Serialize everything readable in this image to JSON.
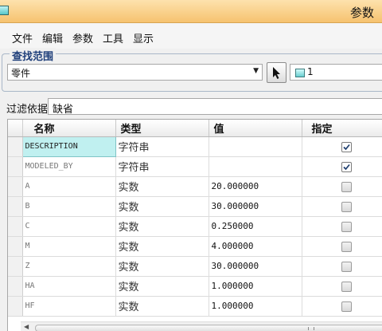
{
  "window": {
    "title": "参数"
  },
  "menu": [
    {
      "label": "文件"
    },
    {
      "label": "编辑"
    },
    {
      "label": "参数"
    },
    {
      "label": "工具"
    },
    {
      "label": "显示"
    }
  ],
  "search_range": {
    "title": "查找范围",
    "scope_value": "零件",
    "selected_item": "1"
  },
  "filter": {
    "label": "过滤依据",
    "value": "缺省"
  },
  "table": {
    "columns": [
      "名称",
      "类型",
      "值",
      "指定"
    ],
    "rows": [
      {
        "name": "DESCRIPTION",
        "type": "字符串",
        "value": "",
        "designated": true
      },
      {
        "name": "MODELED_BY",
        "type": "字符串",
        "value": "",
        "designated": true
      },
      {
        "name": "A",
        "type": "实数",
        "value": "20.000000",
        "designated": false
      },
      {
        "name": "B",
        "type": "实数",
        "value": "30.000000",
        "designated": false
      },
      {
        "name": "C",
        "type": "实数",
        "value": "0.250000",
        "designated": false
      },
      {
        "name": "M",
        "type": "实数",
        "value": "4.000000",
        "designated": false
      },
      {
        "name": "Z",
        "type": "实数",
        "value": "30.000000",
        "designated": false
      },
      {
        "name": "HA",
        "type": "实数",
        "value": "1.000000",
        "designated": false
      },
      {
        "name": "HF",
        "type": "实数",
        "value": "1.000000",
        "designated": false
      }
    ]
  }
}
